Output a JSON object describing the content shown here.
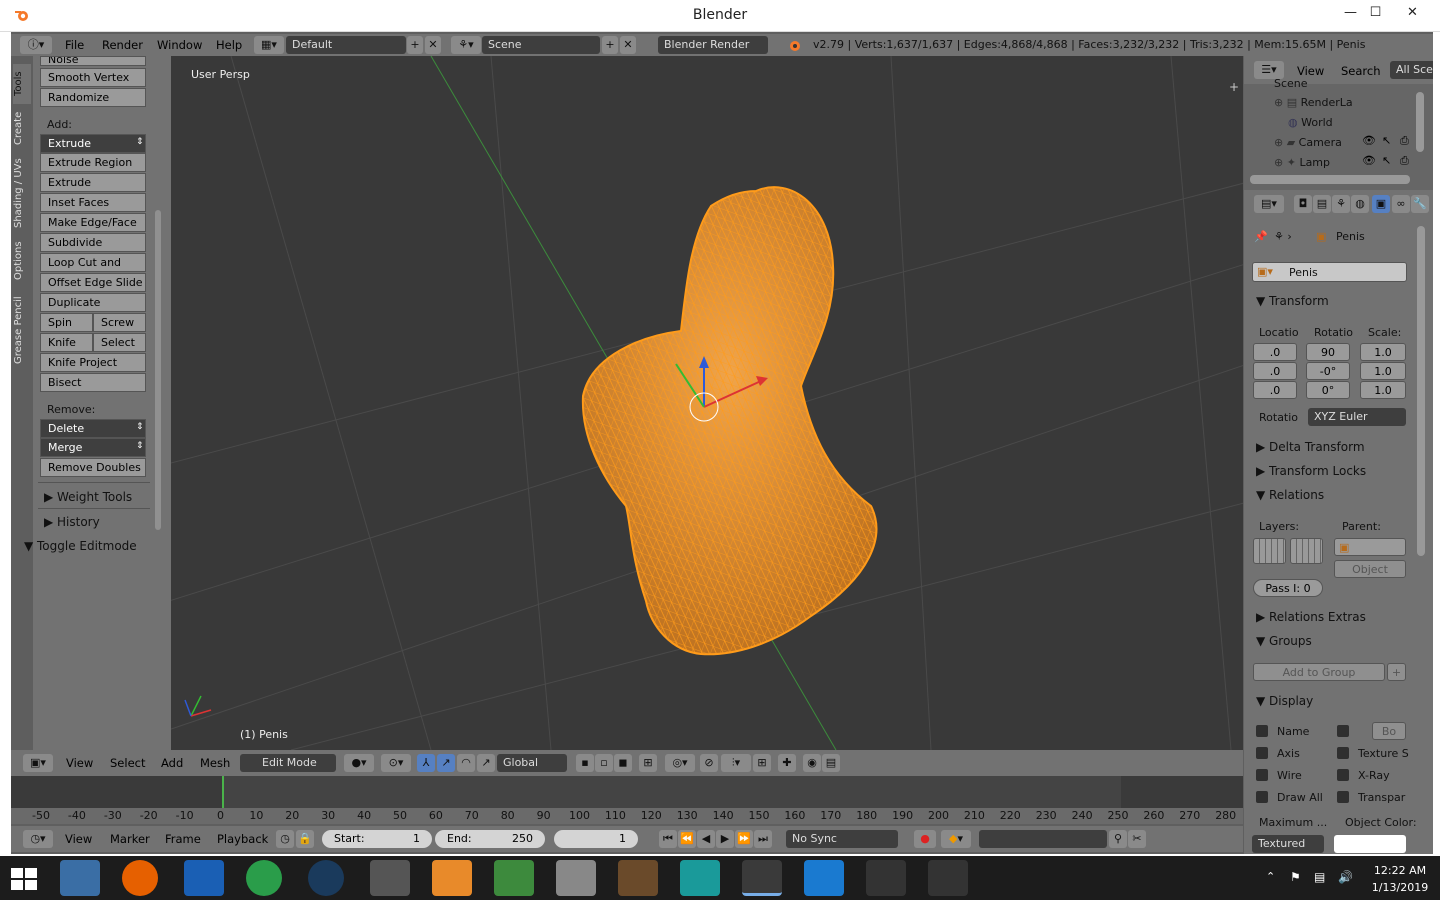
{
  "window": {
    "title": "Blender",
    "minimize": "—",
    "maximize": "☐",
    "close": "✕"
  },
  "info_header": {
    "menus": [
      "File",
      "Render",
      "Window",
      "Help"
    ],
    "layout": "Default",
    "scene": "Scene",
    "engine": "Blender Render",
    "stats": "v2.79 | Verts:1,637/1,637 | Edges:4,868/4,868 | Faces:3,232/3,232 | Tris:3,232 | Mem:15.65M | Penis"
  },
  "toolshelf": {
    "tabs": [
      "Tools",
      "Create",
      "Shading / UVs",
      "Options",
      "Grease Pencil"
    ],
    "top_items": [
      "Noise",
      "Smooth Vertex",
      "Randomize"
    ],
    "add_label": "Add:",
    "extrude": "Extrude",
    "add_items": [
      "Extrude Region",
      "Extrude Individual",
      "Inset Faces",
      "Make Edge/Face",
      "Subdivide",
      "Loop Cut and Slide",
      "Offset Edge Slide",
      "Duplicate"
    ],
    "spin": "Spin",
    "screw": "Screw",
    "knife": "Knife",
    "select": "Select",
    "knife_project": "Knife Project",
    "bisect": "Bisect",
    "remove_label": "Remove:",
    "delete": "Delete",
    "merge": "Merge",
    "remove_doubles": "Remove Doubles",
    "weight_tools": "Weight Tools",
    "history": "History",
    "toggle_editmode": "Toggle Editmode"
  },
  "viewport": {
    "view_name": "User Persp",
    "object_label": "(1) Penis",
    "wire_color": "#ff9b1a",
    "grid_color": "#4a4a4a"
  },
  "v3d_header": {
    "menus": [
      "View",
      "Select",
      "Add",
      "Mesh"
    ],
    "mode": "Edit Mode",
    "orientation": "Global"
  },
  "timeline": {
    "ticks": [
      "-50",
      "-40",
      "-30",
      "-20",
      "-10",
      "0",
      "10",
      "20",
      "30",
      "40",
      "50",
      "60",
      "70",
      "80",
      "90",
      "100",
      "110",
      "120",
      "130",
      "140",
      "150",
      "160",
      "170",
      "180",
      "190",
      "200",
      "210",
      "220",
      "230",
      "240",
      "250",
      "260",
      "270",
      "280"
    ]
  },
  "tl_header": {
    "menus": [
      "View",
      "Marker",
      "Frame",
      "Playback"
    ],
    "start_label": "Start:",
    "start": "1",
    "end_label": "End:",
    "end": "250",
    "current": "1",
    "sync": "No Sync"
  },
  "outliner": {
    "menus": [
      "View",
      "Search"
    ],
    "filter": "All Sce",
    "items": [
      "Scene",
      "RenderLa",
      "World",
      "Camera",
      "Lamp"
    ]
  },
  "properties": {
    "object_path": "Penis",
    "object_name": "Penis",
    "transform": "Transform",
    "loc_label": "Locatio",
    "rot_label": "Rotatio",
    "scale_label": "Scale:",
    "loc": [
      ".0",
      ".0",
      ".0"
    ],
    "rot": [
      "90",
      "-0°",
      "0°"
    ],
    "scale": [
      "1.0",
      "1.0",
      "1.0"
    ],
    "rot_mode_label": "Rotatio",
    "rot_mode": "XYZ Euler",
    "delta": "Delta Transform",
    "locks": "Transform Locks",
    "relations": "Relations",
    "layers_label": "Layers:",
    "parent_label": "Parent:",
    "parent_type": "Object",
    "pass_index": "Pass I: 0",
    "relations_extras": "Relations Extras",
    "groups": "Groups",
    "add_to_group": "Add to Group",
    "display": "Display",
    "name": "Name",
    "bounds": "Bo",
    "axis": "Axis",
    "texture_space": "Texture S",
    "wire": "Wire",
    "xray": "X-Ray",
    "draw_all": "Draw All",
    "transparent": "Transpar",
    "maximum": "Maximum ...",
    "object_color": "Object Color:",
    "draw_type": "Textured"
  },
  "taskbar": {
    "time": "12:22 AM",
    "date": "1/13/2019"
  }
}
